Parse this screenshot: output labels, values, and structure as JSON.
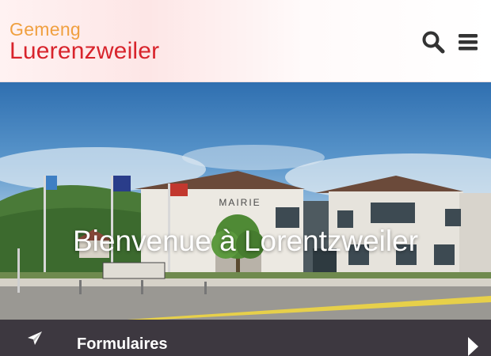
{
  "header": {
    "logo_line1": "Gemeng",
    "logo_line2": "Luerenzweiler",
    "logo_color_top": "#f0a040",
    "logo_color_main": "#d8242c"
  },
  "hero": {
    "title": "Bienvenue à Lorentzweiler",
    "building_sign": "MAIRIE"
  },
  "quick_links": {
    "label": "Formulaires",
    "icon": "paper-plane-icon",
    "next_icon": "caret-right-icon",
    "background": "#3d3840"
  }
}
